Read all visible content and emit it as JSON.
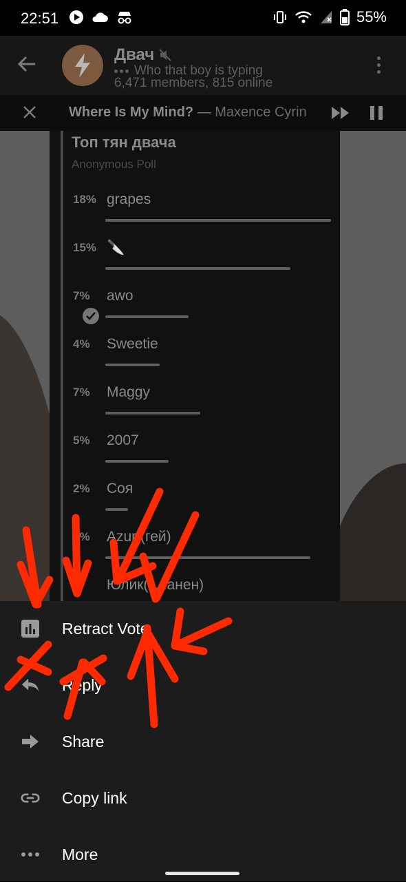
{
  "status_bar": {
    "time": "22:51",
    "battery_percent": "55%"
  },
  "header": {
    "title": "Двач",
    "typing_status": "Who that boy is typing",
    "members": "6,471 members, 815 online"
  },
  "player": {
    "song_title": "Where Is My Mind?",
    "separator": "—",
    "artist": "Maxence Cyrin"
  },
  "poll": {
    "title": "Топ тян двача",
    "type": "Anonymous Poll",
    "options": [
      {
        "percent": "18%",
        "label": "grapes",
        "fraction": 0.18,
        "bar_frac": 1.0
      },
      {
        "percent": "15%",
        "label": "🔪",
        "fraction": 0.15,
        "bar_frac": 0.82
      },
      {
        "percent": "7%",
        "label": "awo",
        "fraction": 0.07,
        "bar_frac": 0.37,
        "voted": true
      },
      {
        "percent": "4%",
        "label": "Sweetie",
        "fraction": 0.04,
        "bar_frac": 0.24
      },
      {
        "percent": "7%",
        "label": "Maggy",
        "fraction": 0.07,
        "bar_frac": 0.42
      },
      {
        "percent": "5%",
        "label": "2007",
        "fraction": 0.05,
        "bar_frac": 0.28
      },
      {
        "percent": "2%",
        "label": "Соя",
        "fraction": 0.02,
        "bar_frac": 0.1
      },
      {
        "percent": "6%",
        "label": "Azur (гей)",
        "fraction": 0.06,
        "bar_frac": 0.91
      },
      {
        "percent": "%",
        "label": "Юлик(з...анен)",
        "fraction": 0.0,
        "bar_frac": 0.0
      }
    ]
  },
  "sheet": {
    "items": [
      {
        "label": "Retract Vote",
        "icon": "bar-chart-icon"
      },
      {
        "label": "Reply",
        "icon": "reply-icon"
      },
      {
        "label": "Share",
        "icon": "share-arrow-icon"
      },
      {
        "label": "Copy link",
        "icon": "link-icon"
      },
      {
        "label": "More",
        "icon": "more-dots-icon"
      }
    ]
  },
  "colors": {
    "annotation_red": "#ff2a00",
    "sheet_bg": "#1c1c1c"
  }
}
